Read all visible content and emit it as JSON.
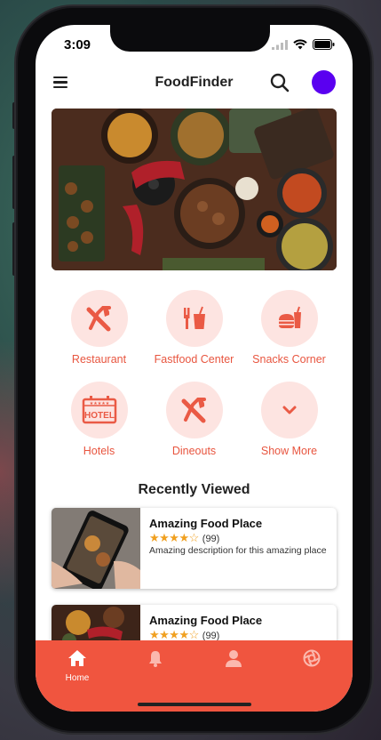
{
  "status": {
    "time": "3:09"
  },
  "header": {
    "title": "FoodFinder"
  },
  "categories": [
    {
      "label": "Restaurant",
      "icon": "fork-knife-icon"
    },
    {
      "label": "Fastfood Center",
      "icon": "fastfood-icon"
    },
    {
      "label": "Snacks Corner",
      "icon": "snacks-icon"
    },
    {
      "label": "Hotels",
      "icon": "hotel-icon"
    },
    {
      "label": "Dineouts",
      "icon": "fork-knife-icon"
    },
    {
      "label": "Show More",
      "icon": "chevron-down-icon"
    }
  ],
  "recent": {
    "title": "Recently Viewed",
    "items": [
      {
        "name": "Amazing Food Place",
        "rating": 4,
        "reviews": "(99)",
        "description": "Amazing description for this amazing place"
      },
      {
        "name": "Amazing Food Place",
        "rating": 4,
        "reviews": "(99)",
        "description": ""
      }
    ]
  },
  "tabbar": {
    "items": [
      {
        "label": "Home",
        "icon": "home-icon",
        "active": true
      },
      {
        "label": "",
        "icon": "bell-icon",
        "active": false
      },
      {
        "label": "",
        "icon": "user-icon",
        "active": false
      },
      {
        "label": "",
        "icon": "aperture-icon",
        "active": false
      }
    ]
  },
  "colors": {
    "accent": "#f0553f",
    "avatar": "#5a00f0",
    "category_bg": "#fde4e1",
    "star": "#f0a020"
  }
}
